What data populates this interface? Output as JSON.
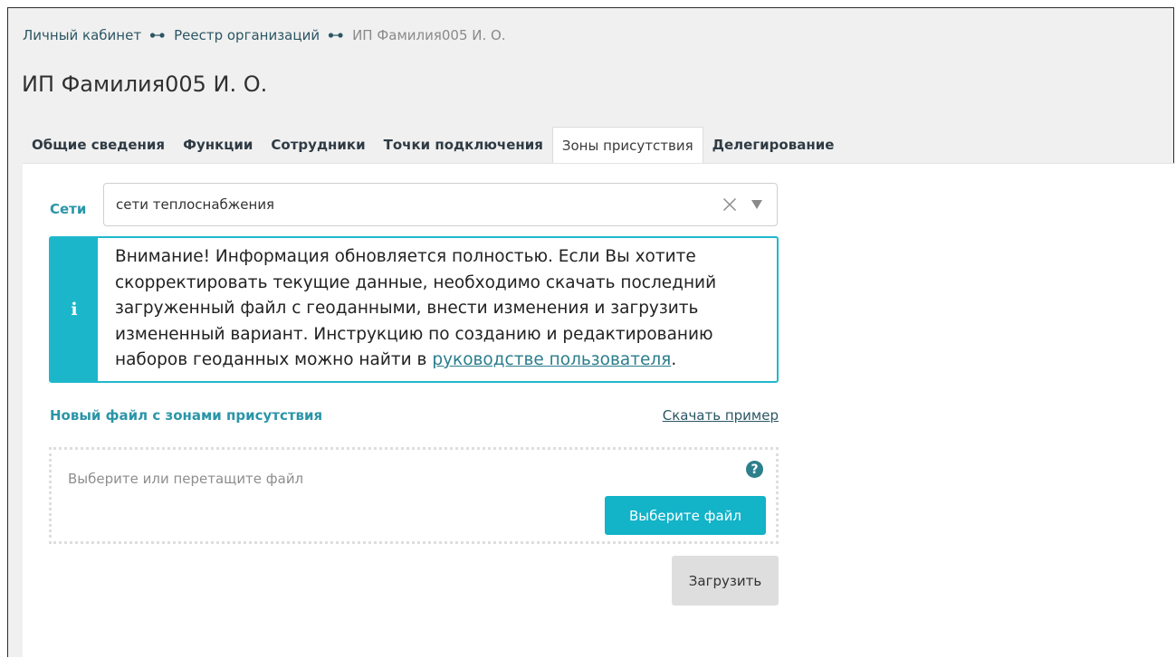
{
  "breadcrumb": {
    "items": [
      {
        "label": "Личный кабинет"
      },
      {
        "label": "Реестр организаций"
      }
    ],
    "current": "ИП Фамилия005 И. О.",
    "separator_icon": "dots-arrow-icon"
  },
  "page": {
    "title": "ИП Фамилия005 И. О."
  },
  "tabs": [
    {
      "label": "Общие сведения",
      "active": false
    },
    {
      "label": "Функции",
      "active": false
    },
    {
      "label": "Сотрудники",
      "active": false
    },
    {
      "label": "Точки подключения",
      "active": false
    },
    {
      "label": "Зоны присутствия",
      "active": true
    },
    {
      "label": "Делегирование",
      "active": false
    }
  ],
  "networks": {
    "label": "Сети",
    "selected_value": "сети теплоснабжения",
    "clear_icon": "close-icon",
    "dropdown_icon": "triangle-down-icon"
  },
  "info_box": {
    "icon": "info-icon",
    "icon_glyph": "i",
    "text_before_link": "Внимание! Информация обновляется полностью. Если Вы хотите скорректировать текущие данные, необходимо скачать последний загруженный файл с геоданными, внести изменения и загрузить измененный вариант. Инструкцию по созданию и редактированию наборов геоданных можно найти в ",
    "link_text": "руководстве пользователя",
    "text_after_link": "."
  },
  "upload_section": {
    "title": "Новый файл с зонами присутствия",
    "download_example": "Скачать пример",
    "dropzone_hint": "Выберите или перетащите файл",
    "help_icon": "question-circle-icon",
    "help_glyph": "?",
    "choose_file_button": "Выберите файл",
    "upload_button": "Загрузить"
  },
  "colors": {
    "accent": "#13b3c8",
    "link": "#2b5663",
    "section_title": "#2b95a8",
    "background": "#f0f0f0"
  }
}
